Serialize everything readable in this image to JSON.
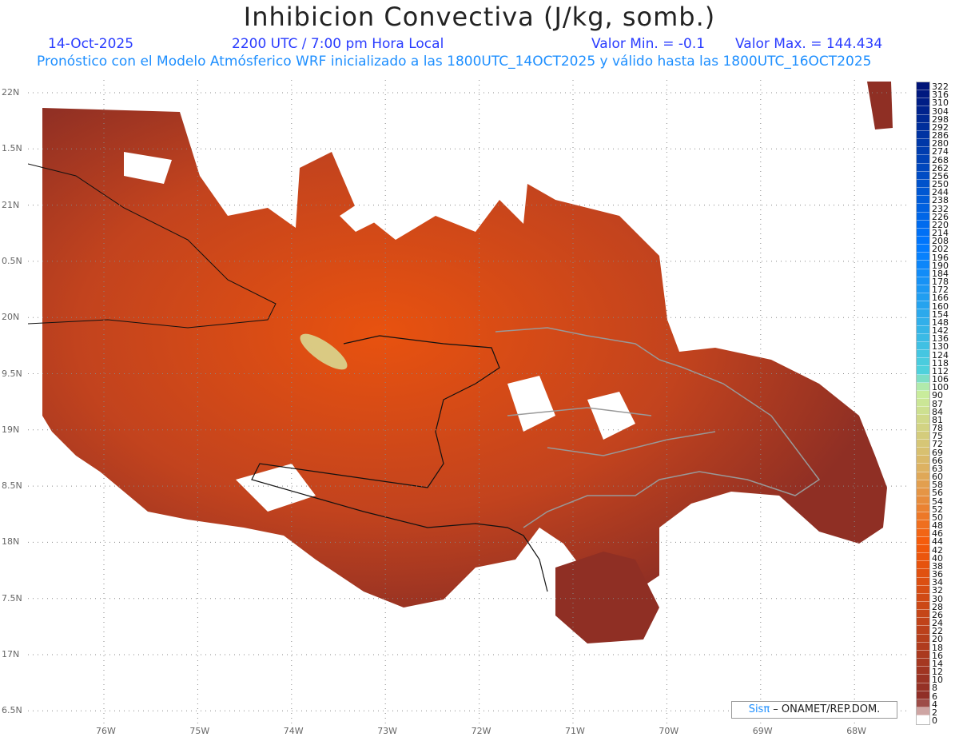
{
  "header": {
    "title": "Inhibicion Convectiva (J/kg, somb.)",
    "date": "14-Oct-2025",
    "time": "2200 UTC / 7:00 pm Hora Local",
    "valor_min": "Valor Min. = -0.1",
    "valor_max": "Valor Max. = 144.434",
    "subtitle": "Pronóstico con el Modelo Atmósferico WRF inicializado a las 1800UTC_14OCT2025 y válido hasta las  1800UTC_16OCT2025"
  },
  "axes": {
    "lon_labels": [
      "76W",
      "75W",
      "74W",
      "73W",
      "72W",
      "71W",
      "70W",
      "69W",
      "68W"
    ],
    "lat_labels": [
      "22N",
      "1.5N",
      "21N",
      "0.5N",
      "20N",
      "9.5N",
      "19N",
      "8.5N",
      "18N",
      "7.5N",
      "17N",
      "6.5N"
    ]
  },
  "colorbar": {
    "labels": [
      "322",
      "316",
      "310",
      "304",
      "298",
      "292",
      "286",
      "280",
      "274",
      "268",
      "262",
      "256",
      "250",
      "244",
      "238",
      "232",
      "226",
      "220",
      "214",
      "208",
      "202",
      "196",
      "190",
      "184",
      "178",
      "172",
      "166",
      "160",
      "154",
      "148",
      "142",
      "136",
      "130",
      "124",
      "118",
      "112",
      "106",
      "100",
      "90",
      "87",
      "84",
      "81",
      "78",
      "75",
      "72",
      "69",
      "66",
      "63",
      "60",
      "58",
      "56",
      "54",
      "52",
      "50",
      "48",
      "46",
      "44",
      "42",
      "40",
      "38",
      "36",
      "34",
      "32",
      "30",
      "28",
      "26",
      "24",
      "22",
      "20",
      "18",
      "16",
      "14",
      "12",
      "10",
      "8",
      "6",
      "4",
      "2",
      "0"
    ]
  },
  "credit": {
    "brand": "Sisπ",
    "text": " – ONAMET/REP.DOM."
  },
  "colors": {
    "land_low": "#8f2f24",
    "land_mid": "#c8441c",
    "land_high": "#f05a10",
    "peak": "#c8f0a0",
    "title_blue": "#2a3cff",
    "subtitle_blue": "#1e8fff"
  }
}
